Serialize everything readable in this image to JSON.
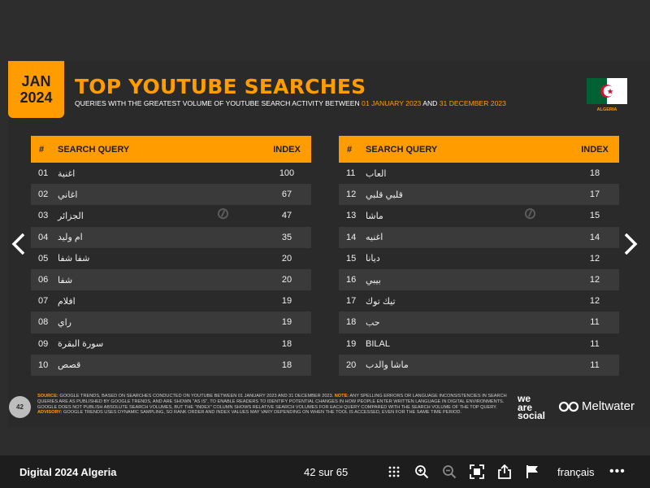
{
  "slide": {
    "date_month": "JAN",
    "date_year": "2024",
    "title": "TOP YOUTUBE SEARCHES",
    "subtitle_prefix": "QUERIES WITH THE GREATEST VOLUME OF YOUTUBE SEARCH ACTIVITY BETWEEN ",
    "subtitle_start": "01 JANUARY 2023",
    "subtitle_and": " AND ",
    "subtitle_end": "31 DECEMBER 2023",
    "country": "ALGERIA",
    "page_number": "42",
    "headers": {
      "num": "#",
      "query": "SEARCH QUERY",
      "index": "INDEX"
    },
    "rows_left": [
      {
        "num": "01",
        "query": "اغنية",
        "index": "100"
      },
      {
        "num": "02",
        "query": "اغاني",
        "index": "67"
      },
      {
        "num": "03",
        "query": "الجزائر",
        "index": "47"
      },
      {
        "num": "04",
        "query": "ام وليد",
        "index": "35"
      },
      {
        "num": "05",
        "query": "شفا شفا",
        "index": "20"
      },
      {
        "num": "06",
        "query": "شفا",
        "index": "20"
      },
      {
        "num": "07",
        "query": "افلام",
        "index": "19"
      },
      {
        "num": "08",
        "query": "راي",
        "index": "19"
      },
      {
        "num": "09",
        "query": "سورة البقرة",
        "index": "18"
      },
      {
        "num": "10",
        "query": "قصص",
        "index": "18"
      }
    ],
    "rows_right": [
      {
        "num": "11",
        "query": "العاب",
        "index": "18"
      },
      {
        "num": "12",
        "query": "قلبي قلبي",
        "index": "17"
      },
      {
        "num": "13",
        "query": "ماشا",
        "index": "15"
      },
      {
        "num": "14",
        "query": "اغنيه",
        "index": "14"
      },
      {
        "num": "15",
        "query": "ديانا",
        "index": "12"
      },
      {
        "num": "16",
        "query": "بيبي",
        "index": "12"
      },
      {
        "num": "17",
        "query": "تيك توك",
        "index": "12"
      },
      {
        "num": "18",
        "query": "حب",
        "index": "11"
      },
      {
        "num": "19",
        "query": "BILAL",
        "index": "11"
      },
      {
        "num": "20",
        "query": "ماشا والدب",
        "index": "11"
      }
    ],
    "footnote_source_label": "SOURCE:",
    "footnote_source": " GOOGLE TRENDS, BASED ON SEARCHES CONDUCTED ON YOUTUBE BETWEEN 01 JANUARY 2023 AND 31 DECEMBER 2023. ",
    "footnote_note_label": "NOTE:",
    "footnote_note": " ANY SPELLING ERRORS OR LANGUAGE INCONSISTENCIES IN SEARCH QUERIES ARE AS PUBLISHED BY GOOGLE TRENDS, AND ARE SHOWN \"AS IS\", TO ENABLE READERS TO IDENTIFY POTENTIAL CHANGES IN HOW PEOPLE ENTER WRITTEN LANGUAGE IN DIGITAL ENVIRONMENTS. GOOGLE DOES NOT PUBLISH ABSOLUTE SEARCH VOLUMES, BUT THE \"INDEX\" COLUMN SHOWS RELATIVE SEARCH VOLUMES FOR EACH QUERY COMPARED WITH THE SEARCH VOLUME OF THE TOP QUERY. ",
    "footnote_advisory_label": "ADVISORY:",
    "footnote_advisory": " GOOGLE TRENDS USES DYNAMIC SAMPLING, SO RANK ORDER AND INDEX VALUES MAY VARY DEPENDING ON WHEN THE TOOL IS ACCESSED, EVEN FOR THE SAME TIME PERIOD.",
    "brand_was_1": "we",
    "brand_was_2": "are",
    "brand_was_3": "social",
    "brand_meltwater": "Meltwater"
  },
  "viewer": {
    "doc_title": "Digital 2024 Algeria",
    "page_count": "42 sur 65",
    "language": "français",
    "more": "•••"
  },
  "colors": {
    "accent": "#ff9c00",
    "background": "#2a2a2a",
    "bar": "#1d1d1d"
  }
}
